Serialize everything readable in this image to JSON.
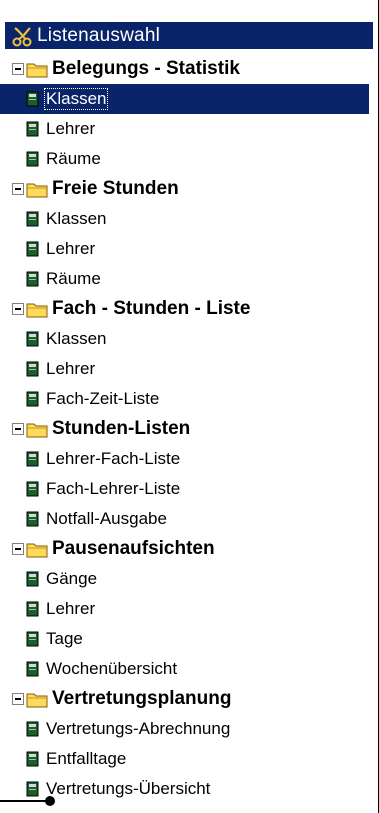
{
  "window": {
    "title": "Listenauswahl",
    "title_icon": "scissors-tool-icon"
  },
  "colors": {
    "titlebar_bg": "#0a246a",
    "selection_bg": "#0a246a",
    "folder_yellow": "#ffd95c",
    "doc_green": "#1a5e2c"
  },
  "tree": {
    "groups": [
      {
        "label": "Belegungs - Statistik",
        "items": [
          {
            "label": "Klassen",
            "selected": true
          },
          {
            "label": "Lehrer"
          },
          {
            "label": "Räume"
          }
        ]
      },
      {
        "label": "Freie Stunden",
        "items": [
          {
            "label": "Klassen"
          },
          {
            "label": "Lehrer"
          },
          {
            "label": "Räume"
          }
        ]
      },
      {
        "label": "Fach - Stunden - Liste",
        "items": [
          {
            "label": "Klassen"
          },
          {
            "label": "Lehrer"
          },
          {
            "label": "Fach-Zeit-Liste"
          }
        ]
      },
      {
        "label": "Stunden-Listen",
        "items": [
          {
            "label": "Lehrer-Fach-Liste"
          },
          {
            "label": "Fach-Lehrer-Liste"
          },
          {
            "label": "Notfall-Ausgabe"
          }
        ]
      },
      {
        "label": "Pausenaufsichten",
        "items": [
          {
            "label": "Gänge"
          },
          {
            "label": "Lehrer"
          },
          {
            "label": "Tage"
          },
          {
            "label": "Wochenübersicht"
          }
        ]
      },
      {
        "label": "Vertretungsplanung",
        "items": [
          {
            "label": "Vertretungs-Abrechnung"
          },
          {
            "label": "Entfalltage"
          },
          {
            "label": "Vertretungs-Übersicht"
          }
        ]
      }
    ]
  }
}
